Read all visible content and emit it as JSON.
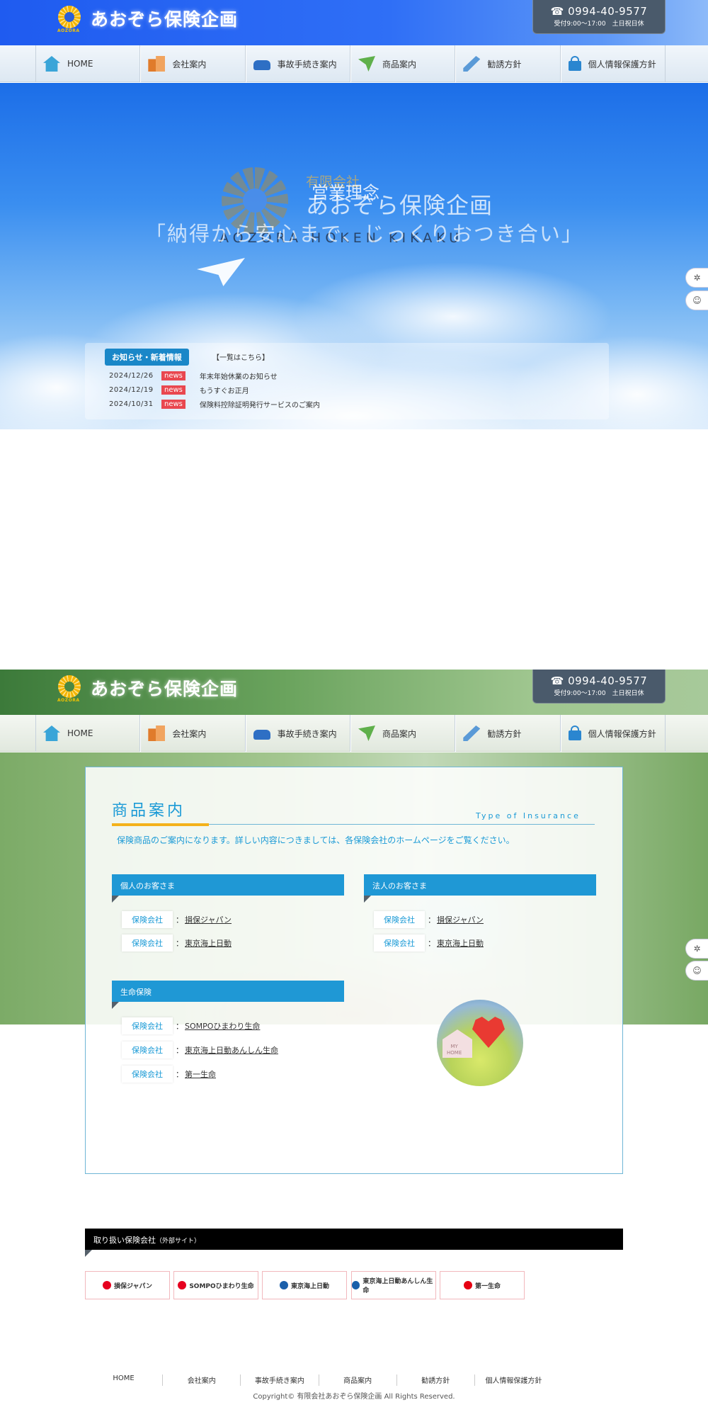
{
  "site": {
    "logo_sub": "AOZORA",
    "title": "あおぞら保険企画",
    "tel": "☎ 0994-40-9577",
    "hours": "受付9:00～17:00　土日祝日休"
  },
  "nav": [
    {
      "label": "HOME",
      "icon": "home-icon"
    },
    {
      "label": "会社案内",
      "icon": "building-icon"
    },
    {
      "label": "事故手続き案内",
      "icon": "car-icon"
    },
    {
      "label": "商品案内",
      "icon": "paper-plane-icon"
    },
    {
      "label": "勧誘方針",
      "icon": "pencil-icon"
    },
    {
      "label": "個人情報保護方針",
      "icon": "lock-icon"
    }
  ],
  "hero": {
    "company_type": "有限会社",
    "company": "あおぞら保険企画",
    "romaji": "AOZORA HOKEN KIKAKU",
    "philosophy_title": "営業理念",
    "philosophy": "「納得から安心まで、じっくりおつき合い」"
  },
  "news": {
    "heading": "お知らせ・新着情報",
    "more": "【一覧はこちら】",
    "items": [
      {
        "date": "2024/12/26",
        "tag": "news",
        "title": "年末年始休業のお知らせ"
      },
      {
        "date": "2024/12/19",
        "tag": "news",
        "title": "もうすぐお正月"
      },
      {
        "date": "2024/10/31",
        "tag": "news",
        "title": "保険料控除証明発行サービスのご案内"
      }
    ]
  },
  "products": {
    "title": "商品案内",
    "title_en": "Type of Insurance",
    "lead": "保険商品のご案内になります。詳しい内容につきましては、各保険会社のホームページをご覧ください。",
    "label": "保険会社",
    "sep": "：",
    "personal": {
      "heading": "個人のお客さま",
      "companies": [
        "損保ジャパン",
        "東京海上日動"
      ]
    },
    "corporate": {
      "heading": "法人のお客さま",
      "companies": [
        "損保ジャパン",
        "東京海上日動"
      ]
    },
    "life": {
      "heading": "生命保険",
      "companies": [
        "SOMPOひまわり生命",
        "東京海上日動あんしん生命",
        "第一生命"
      ]
    },
    "deco_text": "MY\nHOME"
  },
  "partners": {
    "heading": "取り扱い保険会社",
    "heading_note": "（外部サイト）",
    "items": [
      {
        "label": "損保ジャパン",
        "color": "#e6001f"
      },
      {
        "label": "SOMPOひまわり生命",
        "color": "#e6001f"
      },
      {
        "label": "東京海上日動",
        "color": "#1b5faa"
      },
      {
        "label": "東京海上日動あんしん生命",
        "color": "#1b5faa"
      },
      {
        "label": "第一生命",
        "color": "#e60012"
      }
    ]
  },
  "footer": {
    "links": [
      "HOME",
      "会社案内",
      "事故手続き案内",
      "商品案内",
      "勧誘方針",
      "個人情報保護方針"
    ],
    "copyright": "Copyright© 有限会社あおぞら保険企画 All Rights Reserved."
  }
}
